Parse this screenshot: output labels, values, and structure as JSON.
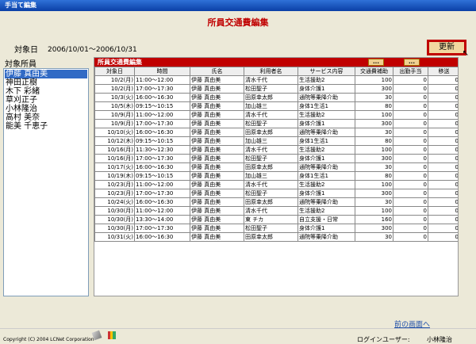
{
  "window": {
    "title": "手当て編集"
  },
  "page": {
    "title": "所員交通費編集"
  },
  "period": {
    "label": "対象日",
    "value": "2006/10/01～2006/10/31"
  },
  "toolbar": {
    "refresh_label": "更新"
  },
  "staff": {
    "label": "対象所員",
    "items": [
      "伊藤 真由美",
      "神田正樹",
      "木下 彩緒",
      "草刈正子",
      "小林隆治",
      "高村 美奈",
      "能美 千恵子"
    ],
    "selected_index": 0
  },
  "table": {
    "title": "所員交通費編集",
    "mini_buttons": [
      "...",
      "..."
    ],
    "headers": [
      "対象日",
      "時間",
      "氏名",
      "利用者名",
      "サービス内容",
      "交通費補助",
      "出勤手当",
      "移送"
    ],
    "rows": [
      [
        "10/2(月)",
        "11:00～12:00",
        "伊藤 真由美",
        "清水千代",
        "生活援助2",
        "100",
        "0",
        "0"
      ],
      [
        "10/2(月)",
        "17:00～17:30",
        "伊藤 真由美",
        "松田聖子",
        "身体介護1",
        "300",
        "0",
        "0"
      ],
      [
        "10/3(火)",
        "16:00～16:30",
        "伊藤 真由美",
        "田原幸太郎",
        "通院等乗降介助",
        "30",
        "0",
        "0"
      ],
      [
        "10/5(木)",
        "09:15～10:15",
        "伊藤 真由美",
        "加山雄三",
        "身体1生活1",
        "80",
        "0",
        "0"
      ],
      [
        "10/9(月)",
        "11:00～12:00",
        "伊藤 真由美",
        "清水千代",
        "生活援助2",
        "100",
        "0",
        "0"
      ],
      [
        "10/9(月)",
        "17:00～17:30",
        "伊藤 真由美",
        "松田聖子",
        "身体介護1",
        "300",
        "0",
        "0"
      ],
      [
        "10/10(火)",
        "16:00～16:30",
        "伊藤 真由美",
        "田原幸太郎",
        "通院等乗降介助",
        "30",
        "0",
        "0"
      ],
      [
        "10/12(木)",
        "09:15～10:15",
        "伊藤 真由美",
        "加山雄三",
        "身体1生活1",
        "80",
        "0",
        "0"
      ],
      [
        "10/16(月)",
        "11:30～12:30",
        "伊藤 真由美",
        "清水千代",
        "生活援助2",
        "100",
        "0",
        "0"
      ],
      [
        "10/16(月)",
        "17:00～17:30",
        "伊藤 真由美",
        "松田聖子",
        "身体介護1",
        "300",
        "0",
        "0"
      ],
      [
        "10/17(火)",
        "16:00～16:30",
        "伊藤 真由美",
        "田原幸太郎",
        "通院等乗降介助",
        "30",
        "0",
        "0"
      ],
      [
        "10/19(木)",
        "09:15～10:15",
        "伊藤 真由美",
        "加山雄三",
        "身体1生活1",
        "80",
        "0",
        "0"
      ],
      [
        "10/23(月)",
        "11:00～12:00",
        "伊藤 真由美",
        "清水千代",
        "生活援助2",
        "100",
        "0",
        "0"
      ],
      [
        "10/23(月)",
        "17:00～17:30",
        "伊藤 真由美",
        "松田聖子",
        "身体介護1",
        "300",
        "0",
        "0"
      ],
      [
        "10/24(火)",
        "16:00～16:30",
        "伊藤 真由美",
        "田原幸太郎",
        "通院等乗降介助",
        "30",
        "0",
        "0"
      ],
      [
        "10/30(月)",
        "11:00～12:00",
        "伊藤 真由美",
        "清水千代",
        "生活援助2",
        "100",
        "0",
        "0"
      ],
      [
        "10/30(月)",
        "13:30～14:00",
        "伊藤 真由美",
        "東 チカ",
        "自立支援・日常",
        "160",
        "0",
        "0"
      ],
      [
        "10/30(月)",
        "17:00～17:30",
        "伊藤 真由美",
        "松田聖子",
        "身体介護1",
        "300",
        "0",
        "0"
      ],
      [
        "10/31(火)",
        "16:00～16:30",
        "伊藤 真由美",
        "田原幸太郎",
        "通院等乗降介助",
        "30",
        "0",
        "0"
      ]
    ]
  },
  "footer": {
    "back_link": "前の画面へ",
    "copyright": "Copyright (C) 2004 LCNet Corporation",
    "login_label": "ログインユーザー:",
    "login_user": "小林隆治"
  }
}
